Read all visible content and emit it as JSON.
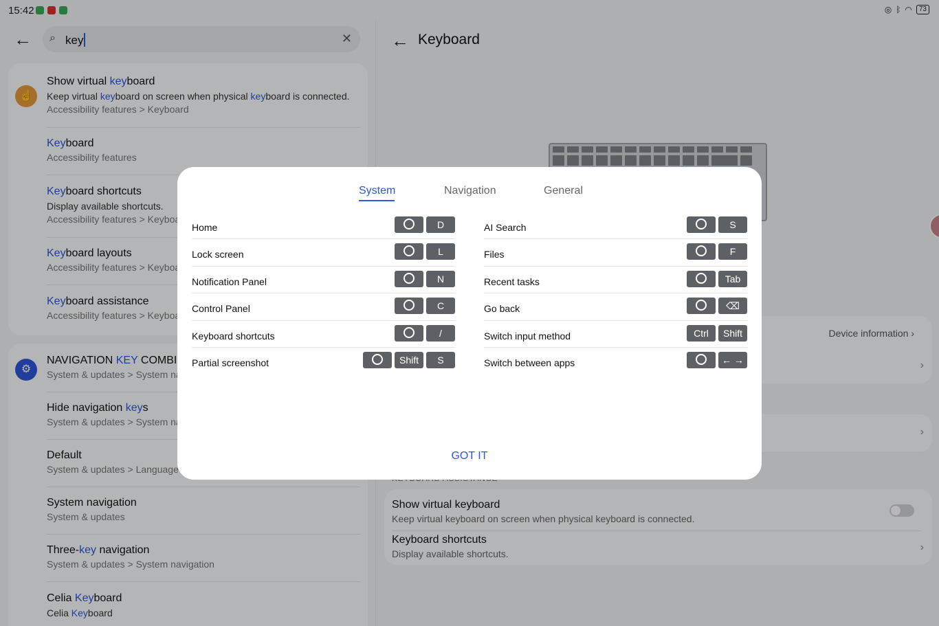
{
  "status": {
    "time": "15:42",
    "battery": "73"
  },
  "search": {
    "query": "key"
  },
  "results_card1": [
    {
      "title_pre": "Show virtual ",
      "title_hl": "key",
      "title_post": "board",
      "sub_pre": "Keep virtual ",
      "sub_hl": "key",
      "sub_mid": "board on screen when physical ",
      "sub_hl2": "key",
      "sub_post": "board is connected.",
      "path": "Accessibility features > Keyboard"
    },
    {
      "title_hl": "Key",
      "title_post": "board",
      "path": "Accessibility features"
    },
    {
      "title_hl": "Key",
      "title_post": "board shortcuts",
      "sub": "Display available shortcuts.",
      "path": "Accessibility features > Keyboa"
    },
    {
      "title_hl": "Key",
      "title_post": "board layouts",
      "path": "Accessibility features > Keyboa"
    },
    {
      "title_hl": "Key",
      "title_post": "board assistance",
      "path": "Accessibility features > Keyboa"
    }
  ],
  "results_card2": [
    {
      "title_pre": "NAVIGATION ",
      "title_hl": "KEY",
      "title_post": " COMBIN",
      "path": "System & updates > System na"
    },
    {
      "title_pre": "Hide navigation ",
      "title_hl": "key",
      "title_post": "s",
      "path": "System & updates > System na"
    },
    {
      "title_pre": "Default",
      "path": "System & updates > Language"
    },
    {
      "title_pre": "System navigation",
      "path": "System & updates"
    },
    {
      "title_pre": "Three-",
      "title_hl": "key",
      "title_post": " navigation",
      "path": "System & updates > System navigation"
    },
    {
      "title_pre": "Celia ",
      "title_hl": "Key",
      "title_post": "board",
      "sub_pre": "Celia ",
      "sub_hl": "Key",
      "sub_post": "board"
    }
  ],
  "right": {
    "title": "Keyboard",
    "device_info": "Device information",
    "section_label": "KEYBOARD ASSISTANCE",
    "show_virtual_title": "Show virtual keyboard",
    "show_virtual_sub": "Keep virtual keyboard on screen when physical keyboard is connected.",
    "show_virtual_on": false,
    "shortcuts_title": "Keyboard shortcuts",
    "shortcuts_sub": "Display available shortcuts."
  },
  "dialog": {
    "tabs": [
      "System",
      "Navigation",
      "General"
    ],
    "active_tab": "System",
    "left": [
      {
        "label": "Home",
        "keys": [
          "circle",
          "D"
        ]
      },
      {
        "label": "Lock screen",
        "keys": [
          "circle",
          "L"
        ]
      },
      {
        "label": "Notification Panel",
        "keys": [
          "circle",
          "N"
        ]
      },
      {
        "label": "Control Panel",
        "keys": [
          "circle",
          "C"
        ]
      },
      {
        "label": "Keyboard shortcuts",
        "keys": [
          "circle",
          "/"
        ]
      },
      {
        "label": "Partial screenshot",
        "keys": [
          "circle",
          "Shift",
          "S"
        ]
      }
    ],
    "right": [
      {
        "label": "AI Search",
        "keys": [
          "circle",
          "S"
        ]
      },
      {
        "label": "Files",
        "keys": [
          "circle",
          "F"
        ]
      },
      {
        "label": "Recent tasks",
        "keys": [
          "circle",
          "Tab"
        ]
      },
      {
        "label": "Go back",
        "keys": [
          "circle",
          "⌫"
        ]
      },
      {
        "label": "Switch input method",
        "keys": [
          "Ctrl",
          "Shift"
        ]
      },
      {
        "label": "Switch between apps",
        "keys": [
          "circle",
          "← →"
        ]
      }
    ],
    "confirm": "GOT IT"
  },
  "colors": {
    "accent": "#2f57d9",
    "key_cap": "#5d6166",
    "accessibility_icon": "#e59a3a",
    "settings_icon": "#2f57d9"
  }
}
